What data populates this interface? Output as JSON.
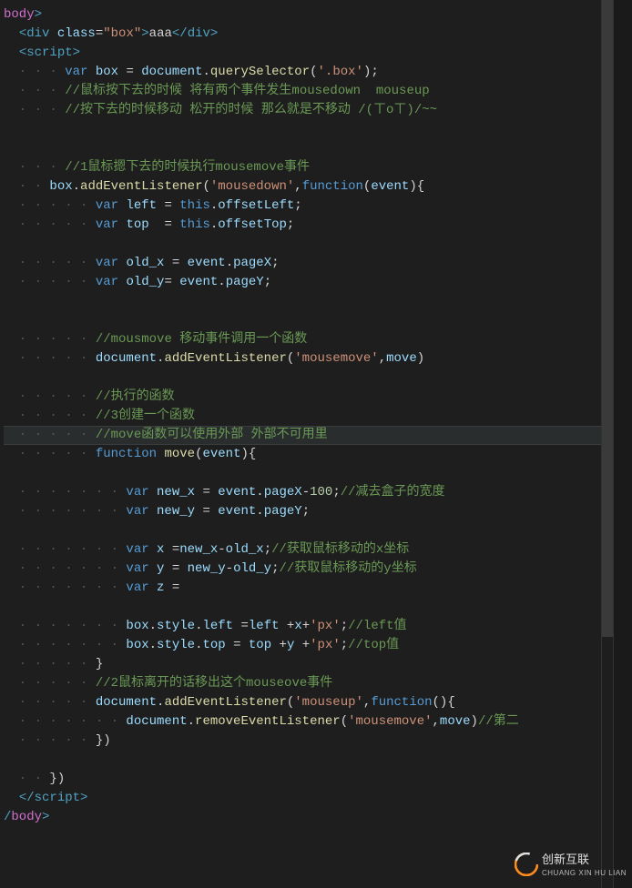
{
  "language": "html-js",
  "editor_theme": "dark",
  "logo": {
    "title": "创新互联",
    "subtitle": "CHUANG XIN HU LIAN"
  },
  "lines": [
    {
      "indent": 0,
      "segs": [
        {
          "t": "body",
          "c": "pnk"
        },
        {
          "t": ">",
          "c": "tag"
        }
      ]
    },
    {
      "indent": 2,
      "dots": 1,
      "segs": [
        {
          "t": "<",
          "c": "tag"
        },
        {
          "t": "div ",
          "c": "tag"
        },
        {
          "t": "class",
          "c": "attr"
        },
        {
          "t": "=",
          "c": "pln"
        },
        {
          "t": "\"box\"",
          "c": "str"
        },
        {
          "t": ">",
          "c": "tag"
        },
        {
          "t": "aaa",
          "c": "pln"
        },
        {
          "t": "</",
          "c": "tag"
        },
        {
          "t": "div",
          "c": "tag"
        },
        {
          "t": ">",
          "c": "tag"
        }
      ]
    },
    {
      "indent": 2,
      "dots": 1,
      "segs": [
        {
          "t": "<",
          "c": "tag"
        },
        {
          "t": "script",
          "c": "tag"
        },
        {
          "t": ">",
          "c": "tag"
        }
      ]
    },
    {
      "indent": 8,
      "dots": 4,
      "segs": [
        {
          "t": "var ",
          "c": "kw"
        },
        {
          "t": "box",
          "c": "attr"
        },
        {
          "t": " = ",
          "c": "pln"
        },
        {
          "t": "document",
          "c": "attr"
        },
        {
          "t": ".",
          "c": "pln"
        },
        {
          "t": "querySelector",
          "c": "fn"
        },
        {
          "t": "(",
          "c": "pln"
        },
        {
          "t": "'.box'",
          "c": "str"
        },
        {
          "t": ");",
          "c": "pln"
        }
      ]
    },
    {
      "indent": 8,
      "dots": 4,
      "segs": [
        {
          "t": "//鼠标按下去的时候 将有两个事件发生mousedown  mouseup",
          "c": "cmt"
        }
      ]
    },
    {
      "indent": 8,
      "dots": 4,
      "segs": [
        {
          "t": "//按下去的时候移动 松开的时候 那么就是不移动 /(ㄒoㄒ)/~~",
          "c": "cmt"
        }
      ]
    },
    {
      "indent": 0,
      "segs": []
    },
    {
      "indent": 0,
      "segs": []
    },
    {
      "indent": 8,
      "dots": 4,
      "segs": [
        {
          "t": "//1鼠标摁下去的时候执行mousemove事件",
          "c": "cmt"
        }
      ]
    },
    {
      "indent": 6,
      "dots": 3,
      "segs": [
        {
          "t": "box",
          "c": "attr"
        },
        {
          "t": ".",
          "c": "pln"
        },
        {
          "t": "addEventListener",
          "c": "fn"
        },
        {
          "t": "(",
          "c": "pln"
        },
        {
          "t": "'mousedown'",
          "c": "str"
        },
        {
          "t": ",",
          "c": "pln"
        },
        {
          "t": "function",
          "c": "kw"
        },
        {
          "t": "(",
          "c": "pln"
        },
        {
          "t": "event",
          "c": "attr"
        },
        {
          "t": ")",
          "c": "pln"
        },
        {
          "t": "{",
          "c": "pln"
        }
      ]
    },
    {
      "indent": 12,
      "dots": 6,
      "segs": [
        {
          "t": "var ",
          "c": "kw"
        },
        {
          "t": "left",
          "c": "attr"
        },
        {
          "t": " = ",
          "c": "pln"
        },
        {
          "t": "this",
          "c": "kw"
        },
        {
          "t": ".",
          "c": "pln"
        },
        {
          "t": "offsetLeft",
          "c": "attr"
        },
        {
          "t": ";",
          "c": "pln"
        }
      ]
    },
    {
      "indent": 12,
      "dots": 6,
      "segs": [
        {
          "t": "var ",
          "c": "kw"
        },
        {
          "t": "top",
          "c": "attr"
        },
        {
          "t": "  = ",
          "c": "pln"
        },
        {
          "t": "this",
          "c": "kw"
        },
        {
          "t": ".",
          "c": "pln"
        },
        {
          "t": "offsetTop",
          "c": "attr"
        },
        {
          "t": ";",
          "c": "pln"
        }
      ]
    },
    {
      "indent": 0,
      "segs": []
    },
    {
      "indent": 12,
      "dots": 6,
      "segs": [
        {
          "t": "var ",
          "c": "kw"
        },
        {
          "t": "old_x",
          "c": "attr"
        },
        {
          "t": " = ",
          "c": "pln"
        },
        {
          "t": "event",
          "c": "attr"
        },
        {
          "t": ".",
          "c": "pln"
        },
        {
          "t": "pageX",
          "c": "attr"
        },
        {
          "t": ";",
          "c": "pln"
        }
      ]
    },
    {
      "indent": 12,
      "dots": 6,
      "segs": [
        {
          "t": "var ",
          "c": "kw"
        },
        {
          "t": "old_y",
          "c": "attr"
        },
        {
          "t": "= ",
          "c": "pln"
        },
        {
          "t": "event",
          "c": "attr"
        },
        {
          "t": ".",
          "c": "pln"
        },
        {
          "t": "pageY",
          "c": "attr"
        },
        {
          "t": ";",
          "c": "pln"
        }
      ]
    },
    {
      "indent": 0,
      "segs": []
    },
    {
      "indent": 0,
      "segs": []
    },
    {
      "indent": 12,
      "dots": 6,
      "segs": [
        {
          "t": "//mousmove 移动事件调用一个函数",
          "c": "cmt"
        }
      ]
    },
    {
      "indent": 12,
      "dots": 6,
      "segs": [
        {
          "t": "document",
          "c": "attr"
        },
        {
          "t": ".",
          "c": "pln"
        },
        {
          "t": "addEventListener",
          "c": "fn"
        },
        {
          "t": "(",
          "c": "pln"
        },
        {
          "t": "'mousemove'",
          "c": "str"
        },
        {
          "t": ",",
          "c": "pln"
        },
        {
          "t": "move",
          "c": "attr"
        },
        {
          "t": ")",
          "c": "pln"
        }
      ]
    },
    {
      "indent": 0,
      "segs": []
    },
    {
      "indent": 12,
      "dots": 6,
      "segs": [
        {
          "t": "//执行的函数",
          "c": "cmt"
        }
      ]
    },
    {
      "indent": 12,
      "dots": 6,
      "segs": [
        {
          "t": "//3创建一个函数",
          "c": "cmt"
        }
      ]
    },
    {
      "indent": 12,
      "dots": 6,
      "hl": true,
      "segs": [
        {
          "t": "//move函数可以使用外部 外部不可用里",
          "c": "cmt"
        }
      ]
    },
    {
      "indent": 12,
      "dots": 6,
      "segs": [
        {
          "t": "function ",
          "c": "kw"
        },
        {
          "t": "move",
          "c": "fn"
        },
        {
          "t": "(",
          "c": "pln"
        },
        {
          "t": "event",
          "c": "attr"
        },
        {
          "t": "){",
          "c": "pln"
        }
      ]
    },
    {
      "indent": 0,
      "segs": []
    },
    {
      "indent": 16,
      "dots": 8,
      "segs": [
        {
          "t": "var ",
          "c": "kw"
        },
        {
          "t": "new_x",
          "c": "attr"
        },
        {
          "t": " = ",
          "c": "pln"
        },
        {
          "t": "event",
          "c": "attr"
        },
        {
          "t": ".",
          "c": "pln"
        },
        {
          "t": "pageX",
          "c": "attr"
        },
        {
          "t": "-",
          "c": "pln"
        },
        {
          "t": "100",
          "c": "num"
        },
        {
          "t": ";",
          "c": "pln"
        },
        {
          "t": "//减去盒子的宽度",
          "c": "cmt"
        }
      ]
    },
    {
      "indent": 16,
      "dots": 8,
      "segs": [
        {
          "t": "var ",
          "c": "kw"
        },
        {
          "t": "new_y",
          "c": "attr"
        },
        {
          "t": " = ",
          "c": "pln"
        },
        {
          "t": "event",
          "c": "attr"
        },
        {
          "t": ".",
          "c": "pln"
        },
        {
          "t": "pageY",
          "c": "attr"
        },
        {
          "t": ";",
          "c": "pln"
        }
      ]
    },
    {
      "indent": 0,
      "segs": []
    },
    {
      "indent": 16,
      "dots": 8,
      "segs": [
        {
          "t": "var ",
          "c": "kw"
        },
        {
          "t": "x",
          "c": "attr"
        },
        {
          "t": " =",
          "c": "pln"
        },
        {
          "t": "new_x",
          "c": "attr"
        },
        {
          "t": "-",
          "c": "pln"
        },
        {
          "t": "old_x",
          "c": "attr"
        },
        {
          "t": ";",
          "c": "pln"
        },
        {
          "t": "//获取鼠标移动的x坐标",
          "c": "cmt"
        }
      ]
    },
    {
      "indent": 16,
      "dots": 8,
      "segs": [
        {
          "t": "var ",
          "c": "kw"
        },
        {
          "t": "y",
          "c": "attr"
        },
        {
          "t": " = ",
          "c": "pln"
        },
        {
          "t": "new_y",
          "c": "attr"
        },
        {
          "t": "-",
          "c": "pln"
        },
        {
          "t": "old_y",
          "c": "attr"
        },
        {
          "t": ";",
          "c": "pln"
        },
        {
          "t": "//获取鼠标移动的y坐标",
          "c": "cmt"
        }
      ]
    },
    {
      "indent": 16,
      "dots": 8,
      "segs": [
        {
          "t": "var ",
          "c": "kw"
        },
        {
          "t": "z",
          "c": "attr"
        },
        {
          "t": " = ",
          "c": "pln"
        }
      ]
    },
    {
      "indent": 0,
      "segs": []
    },
    {
      "indent": 16,
      "dots": 8,
      "segs": [
        {
          "t": "box",
          "c": "attr"
        },
        {
          "t": ".",
          "c": "pln"
        },
        {
          "t": "style",
          "c": "attr"
        },
        {
          "t": ".",
          "c": "pln"
        },
        {
          "t": "left",
          "c": "attr"
        },
        {
          "t": " =",
          "c": "pln"
        },
        {
          "t": "left",
          "c": "attr"
        },
        {
          "t": " +",
          "c": "pln"
        },
        {
          "t": "x",
          "c": "attr"
        },
        {
          "t": "+",
          "c": "pln"
        },
        {
          "t": "'px'",
          "c": "str"
        },
        {
          "t": ";",
          "c": "pln"
        },
        {
          "t": "//left值",
          "c": "cmt"
        }
      ]
    },
    {
      "indent": 16,
      "dots": 8,
      "segs": [
        {
          "t": "box",
          "c": "attr"
        },
        {
          "t": ".",
          "c": "pln"
        },
        {
          "t": "style",
          "c": "attr"
        },
        {
          "t": ".",
          "c": "pln"
        },
        {
          "t": "top",
          "c": "attr"
        },
        {
          "t": " = ",
          "c": "pln"
        },
        {
          "t": "top",
          "c": "attr"
        },
        {
          "t": " +",
          "c": "pln"
        },
        {
          "t": "y",
          "c": "attr"
        },
        {
          "t": " +",
          "c": "pln"
        },
        {
          "t": "'px'",
          "c": "str"
        },
        {
          "t": ";",
          "c": "pln"
        },
        {
          "t": "//top值",
          "c": "cmt"
        }
      ]
    },
    {
      "indent": 12,
      "dots": 6,
      "segs": [
        {
          "t": "}",
          "c": "pln"
        }
      ]
    },
    {
      "indent": 12,
      "dots": 6,
      "segs": [
        {
          "t": "//2鼠标离开的话移出这个mouseove事件",
          "c": "cmt"
        }
      ]
    },
    {
      "indent": 12,
      "dots": 6,
      "segs": [
        {
          "t": "document",
          "c": "attr"
        },
        {
          "t": ".",
          "c": "pln"
        },
        {
          "t": "addEventListener",
          "c": "fn"
        },
        {
          "t": "(",
          "c": "pln"
        },
        {
          "t": "'mouseup'",
          "c": "str"
        },
        {
          "t": ",",
          "c": "pln"
        },
        {
          "t": "function",
          "c": "kw"
        },
        {
          "t": "(){",
          "c": "pln"
        }
      ]
    },
    {
      "indent": 16,
      "dots": 8,
      "segs": [
        {
          "t": "document",
          "c": "attr"
        },
        {
          "t": ".",
          "c": "pln"
        },
        {
          "t": "removeEventListener",
          "c": "fn"
        },
        {
          "t": "(",
          "c": "pln"
        },
        {
          "t": "'mousemove'",
          "c": "str"
        },
        {
          "t": ",",
          "c": "pln"
        },
        {
          "t": "move",
          "c": "attr"
        },
        {
          "t": ")",
          "c": "pln"
        },
        {
          "t": "//第二",
          "c": "cmt"
        }
      ]
    },
    {
      "indent": 12,
      "dots": 6,
      "segs": [
        {
          "t": "})",
          "c": "pln"
        }
      ]
    },
    {
      "indent": 0,
      "segs": []
    },
    {
      "indent": 6,
      "dots": 3,
      "segs": [
        {
          "t": "})",
          "c": "pln"
        }
      ]
    },
    {
      "indent": 2,
      "dots": 1,
      "segs": [
        {
          "t": "</",
          "c": "tag"
        },
        {
          "t": "script",
          "c": "tag"
        },
        {
          "t": ">",
          "c": "tag"
        }
      ]
    },
    {
      "indent": 0,
      "segs": [
        {
          "t": "/",
          "c": "tag"
        },
        {
          "t": "body",
          "c": "pnk"
        },
        {
          "t": ">",
          "c": "tag"
        }
      ]
    }
  ]
}
